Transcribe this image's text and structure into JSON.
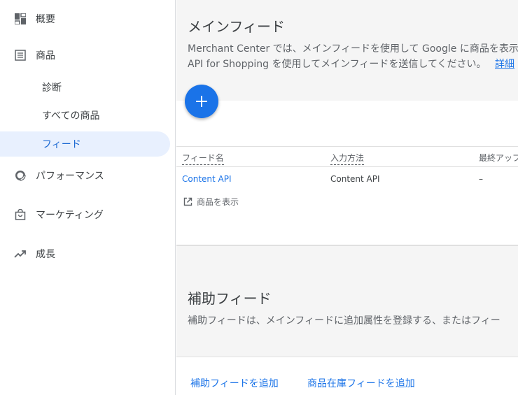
{
  "sidebar": {
    "items": [
      {
        "label": "概要"
      },
      {
        "label": "商品"
      },
      {
        "label": "パフォーマンス"
      },
      {
        "label": "マーケティング"
      },
      {
        "label": "成長"
      }
    ],
    "sub_items": [
      {
        "label": "診断"
      },
      {
        "label": "すべての商品"
      },
      {
        "label": "フィード"
      }
    ]
  },
  "main_feeds": {
    "title": "メインフィード",
    "desc_line1": "Merchant Center では、メインフィードを使用して Google に商品を表示",
    "desc_line2": "API for Shopping を使用してメインフィードを送信してください。",
    "desc_link": "詳細",
    "table": {
      "headers": [
        "フィード名",
        "入力方法",
        "最終アップ"
      ],
      "rows": [
        {
          "name": "Content API",
          "method": "Content API",
          "last_updated": "–"
        }
      ]
    },
    "view_products": "商品を表示"
  },
  "supplemental_feeds": {
    "title": "補助フィード",
    "desc": "補助フィードは、メインフィードに追加属性を登録する、またはフィー"
  },
  "footer": {
    "add_supplemental": "補助フィードを追加",
    "add_inventory": "商品在庫フィードを追加"
  },
  "colors": {
    "accent": "#1a73e8",
    "active_bg": "#e8f0fe"
  }
}
